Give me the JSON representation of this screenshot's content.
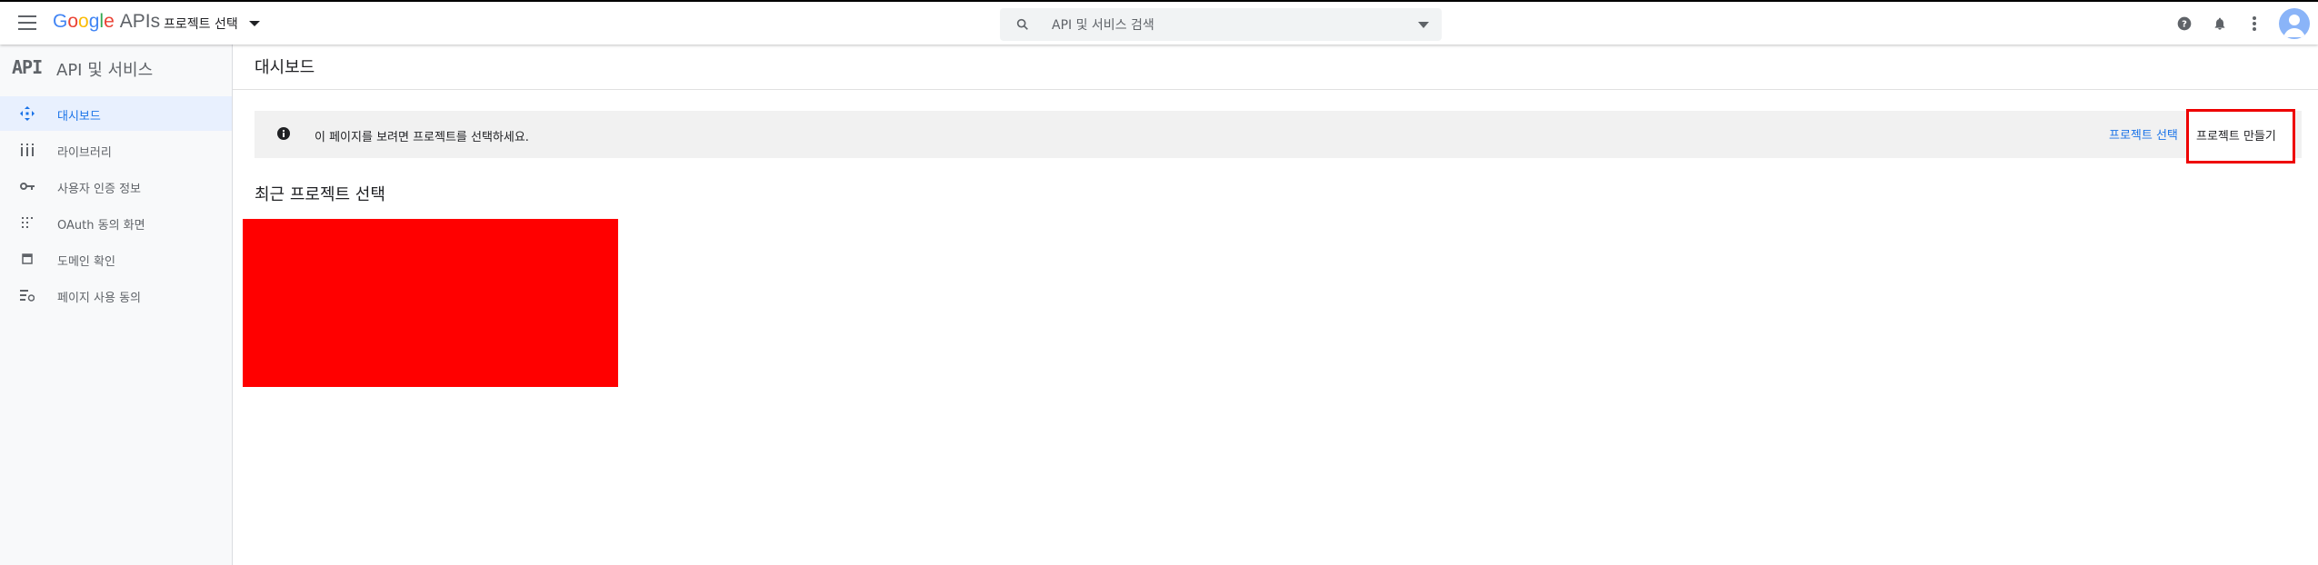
{
  "topbar": {
    "logo_letters": [
      "G",
      "o",
      "o",
      "g",
      "l",
      "e"
    ],
    "logo_suffix": "APIs",
    "project_label": "프로젝트 선택",
    "search_placeholder": "API 및 서비스 검색"
  },
  "sidebar": {
    "logo": "API",
    "title": "API 및 서비스",
    "items": [
      {
        "label": "대시보드",
        "icon": "dashboard-icon",
        "active": true
      },
      {
        "label": "라이브러리",
        "icon": "library-icon"
      },
      {
        "label": "사용자 인증 정보",
        "icon": "key-icon"
      },
      {
        "label": "OAuth 동의 화면",
        "icon": "consent-dots-icon"
      },
      {
        "label": "도메인 확인",
        "icon": "domain-check-icon"
      },
      {
        "label": "페이지 사용 동의",
        "icon": "page-settings-icon"
      }
    ]
  },
  "main": {
    "page_title": "대시보드",
    "banner_text": "이 페이지를 보려면 프로젝트를 선택하세요.",
    "link_select_project": "프로젝트 선택",
    "create_project_label": "프로젝트 만들기",
    "recent_title": "최근 프로젝트 선택"
  },
  "colors": {
    "accent": "#1a73e8",
    "highlight_border": "#ee0000",
    "red_block": "#ff0000",
    "active_bg": "#e8f0fe"
  }
}
